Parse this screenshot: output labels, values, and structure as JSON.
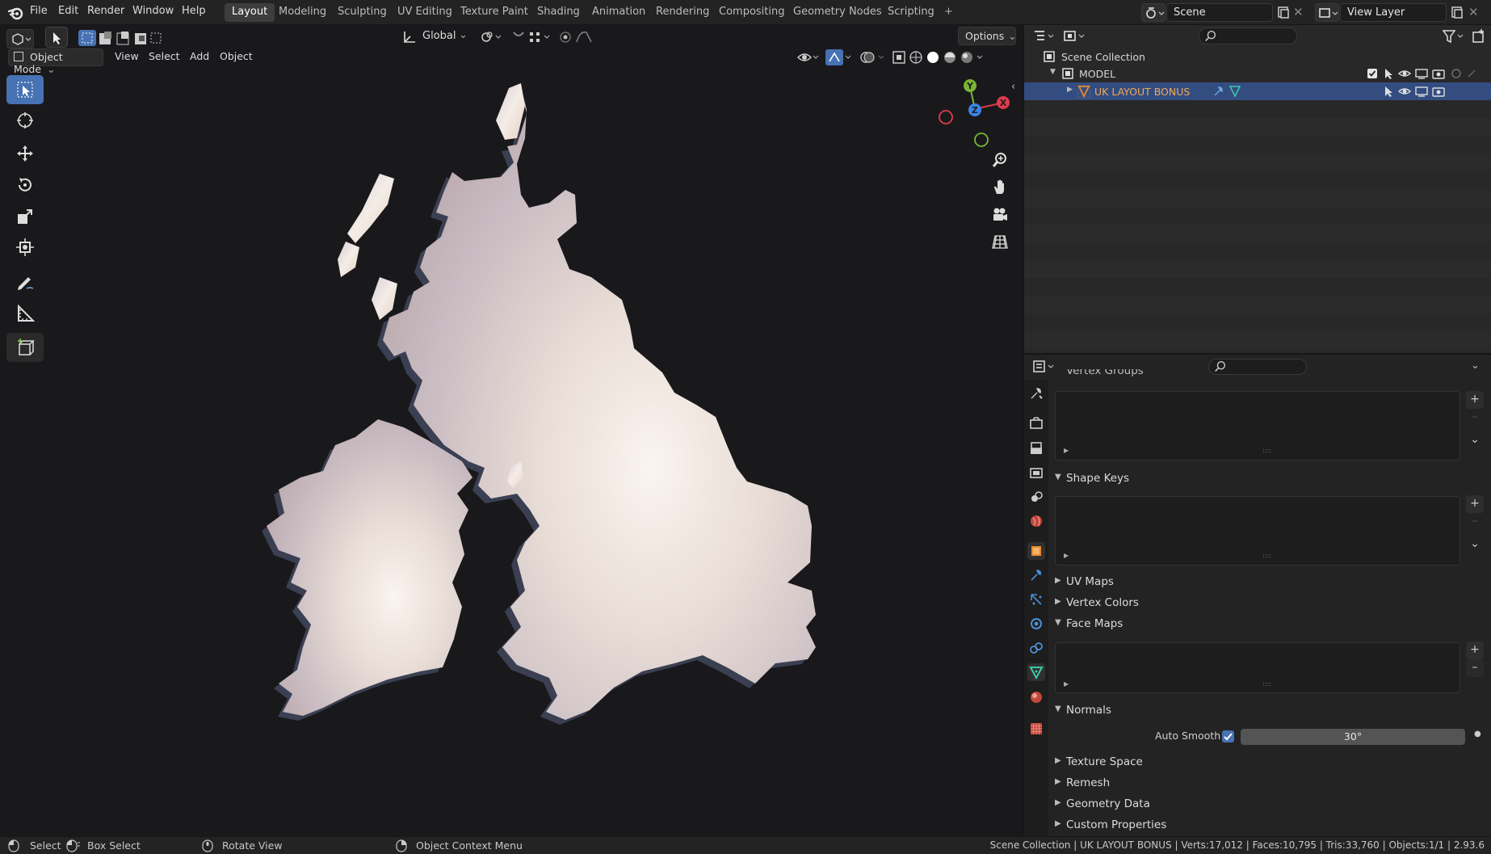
{
  "topbar": {
    "menus": [
      "File",
      "Edit",
      "Render",
      "Window",
      "Help"
    ],
    "workspaces": [
      "Layout",
      "Modeling",
      "Sculpting",
      "UV Editing",
      "Texture Paint",
      "Shading",
      "Animation",
      "Rendering",
      "Compositing",
      "Geometry Nodes",
      "Scripting"
    ],
    "active_workspace": "Layout",
    "add_tab": "+",
    "scene_name": "Scene",
    "view_layer": "View Layer"
  },
  "viewport_header": {
    "orientation": "Global",
    "options_label": "Options",
    "mode": "Object Mode",
    "menus": [
      "View",
      "Select",
      "Add",
      "Object"
    ]
  },
  "navigation_gizmo": {
    "axes": [
      "Y",
      "Z",
      "X"
    ]
  },
  "outliner": {
    "scene_collection": "Scene Collection",
    "collection": "MODEL",
    "object": "UK LAYOUT BONUS"
  },
  "properties": {
    "cut_panel": "Vertex Groups",
    "panels": {
      "shape_keys": "Shape Keys",
      "uv_maps": "UV Maps",
      "vertex_colors": "Vertex Colors",
      "face_maps": "Face Maps",
      "normals": "Normals",
      "texture_space": "Texture Space",
      "remesh": "Remesh",
      "geometry_data": "Geometry Data",
      "custom_properties": "Custom Properties"
    },
    "auto_smooth_label": "Auto Smooth",
    "auto_smooth_checked": true,
    "auto_smooth_angle": "30°",
    "list_handle": "::::"
  },
  "statusbar": {
    "select": "Select",
    "box_select": "Box Select",
    "rotate_view": "Rotate View",
    "context_menu": "Object Context Menu",
    "stats": "Scene Collection | UK LAYOUT BONUS | Verts:17,012 | Faces:10,795 | Tris:33,760 | Objects:1/1 | 2.93.6"
  },
  "colors": {
    "accent": "#4772b3",
    "selection_row": "#334d80",
    "object_orange": "#e88a2e",
    "axis_x": "#e03a4b",
    "axis_y": "#7ab535",
    "axis_z": "#3a86e8"
  }
}
